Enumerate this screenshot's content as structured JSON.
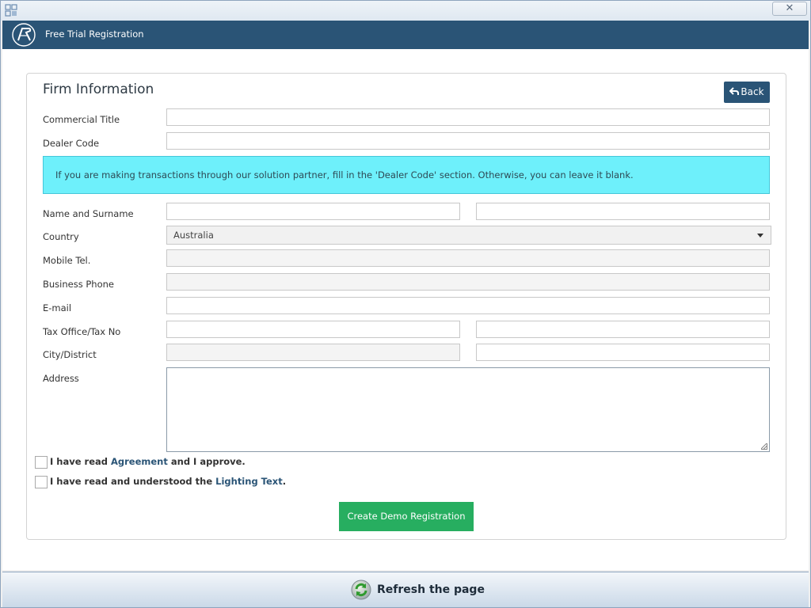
{
  "header": {
    "title": "Free Trial Registration"
  },
  "titlebar": {
    "close_symbol": "✕"
  },
  "form": {
    "title": "Firm Information",
    "back_label": "Back",
    "labels": {
      "commercial_title": "Commercial Title",
      "dealer_code": "Dealer Code",
      "name_surname": "Name and Surname",
      "country": "Country",
      "mobile_tel": "Mobile Tel.",
      "business_phone": "Business Phone",
      "email": "E-mail",
      "tax_office": "Tax Office/Tax No",
      "city_district": "City/District",
      "address": "Address"
    },
    "info_message": "If you are making transactions through our solution partner, fill in the 'Dealer Code' section. Otherwise, you can leave it blank.",
    "country_selected": "Australia",
    "checkbox_agreement": {
      "prefix": "I have read ",
      "link": "Agreement",
      "suffix": " and I approve."
    },
    "checkbox_lighting": {
      "prefix": "I have read and understood the ",
      "link": "Lighting Text",
      "suffix": "."
    },
    "submit_label": "Create Demo Registration"
  },
  "footer": {
    "refresh_label": "Refresh the page"
  },
  "colors": {
    "header_bg": "#2a5476",
    "info_bg": "#6ef0fb",
    "submit_bg": "#27ae60",
    "link": "#2a5476"
  },
  "icons": {
    "app": "app-icon",
    "logo": "brand-logo-icon",
    "back": "back-arrow-icon",
    "dropdown": "chevron-down-icon",
    "refresh": "refresh-icon",
    "close": "close-icon"
  }
}
